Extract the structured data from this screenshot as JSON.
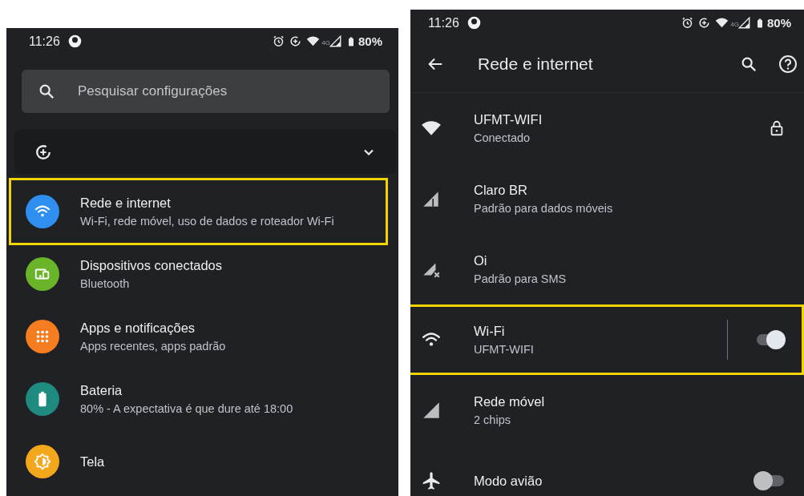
{
  "left_screen": {
    "status_bar": {
      "time": "11:26",
      "network": "4G",
      "battery": "80%"
    },
    "search": {
      "placeholder": "Pesquisar configurações"
    },
    "suggestion": {
      "expanded": false
    },
    "items": [
      {
        "kind": "network",
        "title": "Rede e internet",
        "subtitle": "Wi-Fi, rede móvel, uso de dados e roteador Wi-Fi",
        "color": "#2e8ff0",
        "highlighted": true
      },
      {
        "kind": "devices",
        "title": "Dispositivos conectados",
        "subtitle": "Bluetooth",
        "color": "#6ab42a",
        "highlighted": false
      },
      {
        "kind": "apps",
        "title": "Apps e notificações",
        "subtitle": "Apps recentes, apps padrão",
        "color": "#f57c1f",
        "highlighted": false
      },
      {
        "kind": "battery",
        "title": "Bateria",
        "subtitle": "80% - A expectativa é que dure até 18:00",
        "color": "#1f8a7f",
        "highlighted": false
      },
      {
        "kind": "display",
        "title": "Tela",
        "color": "#f3a81c",
        "highlighted": false
      }
    ]
  },
  "right_screen": {
    "status_bar": {
      "time": "11:26",
      "network": "4G",
      "battery": "80%"
    },
    "toolbar": {
      "title": "Rede e internet"
    },
    "items": [
      {
        "kind": "wifi_network",
        "title": "UFMT-WIFI",
        "subtitle": "Conectado",
        "locked": true,
        "highlighted": false
      },
      {
        "kind": "sim",
        "title": "Claro BR",
        "subtitle": "Padrão para dados móveis",
        "highlighted": false
      },
      {
        "kind": "sim_no_data",
        "title": "Oi",
        "subtitle": "Padrão para SMS",
        "highlighted": false
      },
      {
        "kind": "wifi",
        "title": "Wi-Fi",
        "subtitle": "UFMT-WIFI",
        "on": true,
        "highlighted": true
      },
      {
        "kind": "mobile",
        "title": "Rede móvel",
        "subtitle": "2 chips",
        "highlighted": false
      },
      {
        "kind": "airplane",
        "title": "Modo avião",
        "on": false,
        "highlighted": false
      }
    ]
  }
}
